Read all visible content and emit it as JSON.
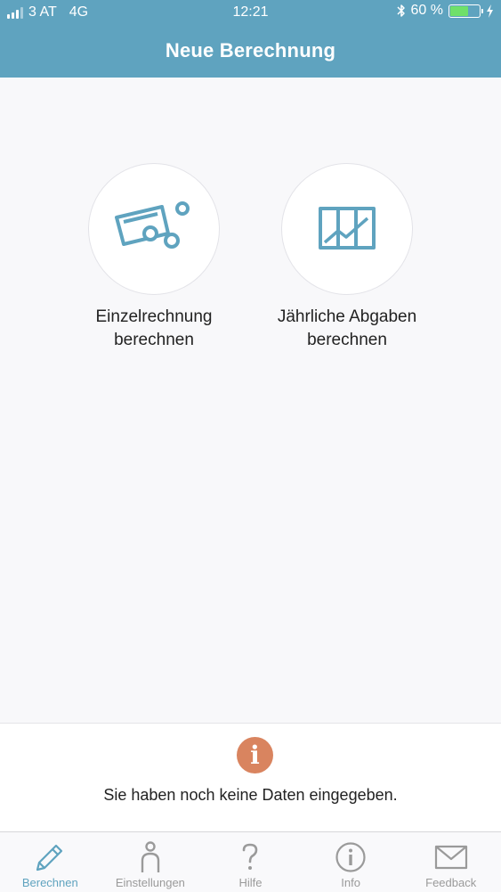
{
  "status_bar": {
    "carrier": "3 AT",
    "network": "4G",
    "time": "12:21",
    "battery_percent": "60 %",
    "battery_level": 0.6,
    "icons": [
      "signal-icon",
      "bluetooth-icon",
      "battery-icon",
      "charging-icon"
    ]
  },
  "nav": {
    "title": "Neue Berechnung"
  },
  "options": [
    {
      "line1": "Einzelrechnung",
      "line2": "berechnen",
      "icon": "single-calculation-icon"
    },
    {
      "line1": "Jährliche Abgaben",
      "line2": "berechnen",
      "icon": "annual-chart-icon"
    }
  ],
  "info": {
    "badge": "i",
    "message": "Sie haben noch keine Daten eingegeben."
  },
  "tabs": [
    {
      "label": "Berechnen",
      "icon": "pencil-icon",
      "active": true
    },
    {
      "label": "Einstellungen",
      "icon": "person-icon",
      "active": false
    },
    {
      "label": "Hilfe",
      "icon": "question-icon",
      "active": false
    },
    {
      "label": "Info",
      "icon": "info-icon",
      "active": false
    },
    {
      "label": "Feedback",
      "icon": "mail-icon",
      "active": false
    }
  ],
  "colors": {
    "header": "#5fa3bf",
    "accent": "#5fa3bf",
    "info_badge": "#d9845f",
    "inactive_tab": "#9a9a9a"
  }
}
